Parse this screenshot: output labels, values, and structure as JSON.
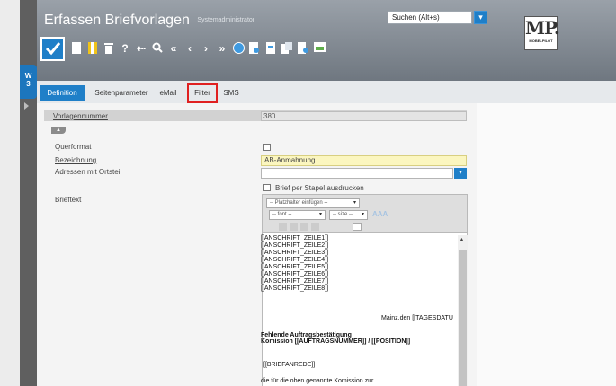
{
  "header": {
    "title": "Erfassen Briefvorlagen",
    "subtitle": "Systemadministrator",
    "search_value": "Suchen (Alt+s)"
  },
  "logo": {
    "text": "MP.",
    "subtext": "MÖBELPILOT"
  },
  "side_tab": {
    "label": "W\n3"
  },
  "tabs": [
    {
      "label": "Definition",
      "active": true
    },
    {
      "label": "Seitenparameter",
      "active": false
    },
    {
      "label": "eMail",
      "active": false
    },
    {
      "label": "Filter",
      "active": false,
      "highlighted": true
    },
    {
      "label": "SMS",
      "active": false
    }
  ],
  "form": {
    "vorlagennummer_label": "Vorlagennummer",
    "vorlagennummer_value": "380",
    "querformat_label": "Querformat",
    "bezeichnung_label": "Bezeichnung",
    "bezeichnung_value": "AB-Anmahnung",
    "adressen_label": "Adressen mit Ortsteil",
    "stapel_label": "Brief per Stapel ausdrucken",
    "brieftext_label": "Brieftext"
  },
  "editor": {
    "placeholder_select": "-- Platzhalter einfügen --",
    "font_select": "-- font --",
    "size_select": "-- size --",
    "lines": [
      "[[ANSCHRIFT_ZEILE1]]",
      "[[ANSCHRIFT_ZEILE2]]",
      "[[ANSCHRIFT_ZEILE3]]",
      "[[ANSCHRIFT_ZEILE4]]",
      "[[ANSCHRIFT_ZEILE5]]",
      "[[ANSCHRIFT_ZEILE6]]",
      "[[ANSCHRIFT_ZEILE7]]",
      "[[ANSCHRIFT_ZEILE8]]"
    ],
    "date_line": "Mainz,den [[TAGESDATU",
    "bold_line1": "Fehlende Auftragsbestätigung",
    "bold_line2": "Komission [[AUFTRAGSNUMMER]] / [[POSITION]]",
    "anrede": "[[BRIEFANREDE]]",
    "body_start": "die für die oben genannte Komission zur"
  },
  "colors": {
    "accent": "#1f7fc8",
    "header": "#8a929b",
    "highlight": "#e02020",
    "yellow_field": "#fbf6bf"
  }
}
